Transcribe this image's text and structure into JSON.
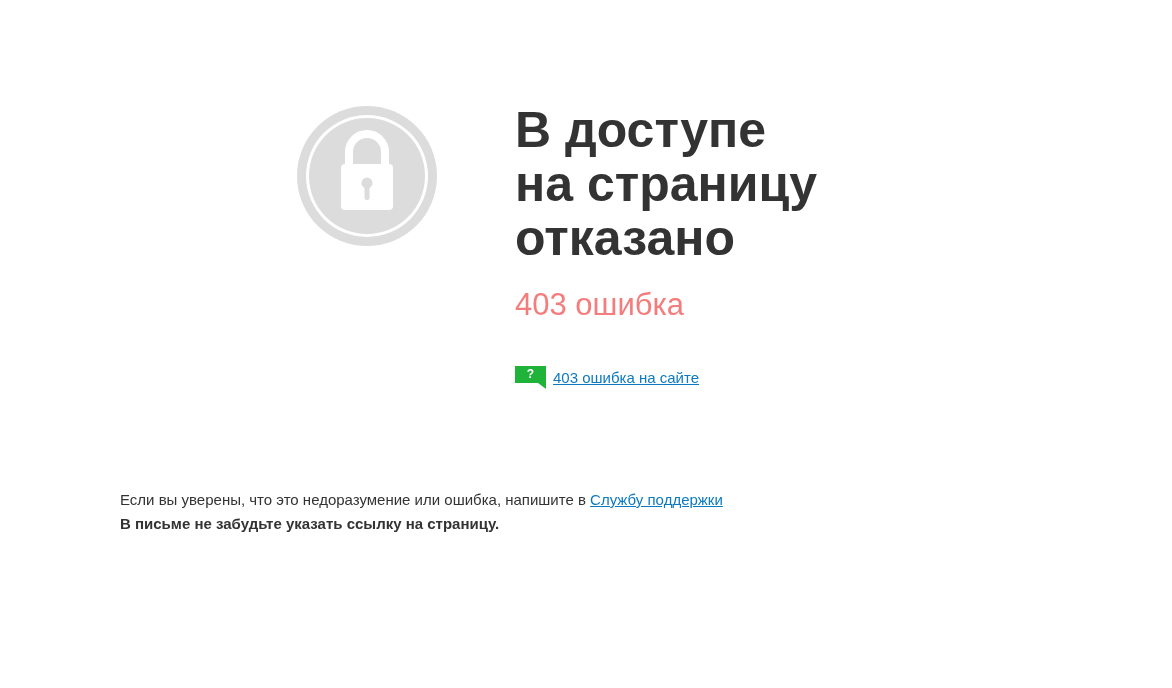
{
  "title_lines": [
    "В доступе",
    "на страницу",
    "отказано"
  ],
  "error_code": "403 ошибка",
  "help_link": {
    "icon_text": "?",
    "label": "403 ошибка на сайте"
  },
  "note": {
    "text": "Если вы уверены, что это недоразумение или ошибка, напишите в ",
    "link": "Службу поддержки"
  },
  "reminder": "В письме не забудьте указать ссылку на страницу."
}
